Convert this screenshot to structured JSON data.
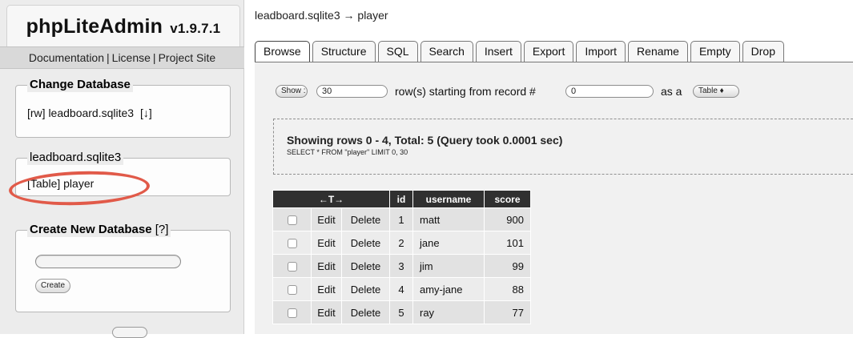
{
  "sidebar": {
    "app_name": "phpLiteAdmin",
    "version": "v1.9.7.1",
    "links": [
      "Documentation",
      "License",
      "Project Site"
    ],
    "link_separator": "|",
    "change_db": {
      "legend": "Change Database",
      "current": "[rw] leadboard.sqlite3",
      "download_icon": "[↓]"
    },
    "db_tables": {
      "legend": "leadboard.sqlite3",
      "table_item": "[Table] player"
    },
    "create_db": {
      "legend": "Create New Database",
      "help": "[?]",
      "name_value": "",
      "button": "Create"
    },
    "annotation_color": "#e15a49"
  },
  "main": {
    "breadcrumb": "leadboard.sqlite3 → player",
    "tabs": [
      {
        "label": "Browse",
        "active": true
      },
      {
        "label": "Structure"
      },
      {
        "label": "SQL"
      },
      {
        "label": "Search"
      },
      {
        "label": "Insert"
      },
      {
        "label": "Export"
      },
      {
        "label": "Import"
      },
      {
        "label": "Rename"
      },
      {
        "label": "Empty"
      },
      {
        "label": "Drop"
      }
    ],
    "show_controls": {
      "show_button": "Show :",
      "rows_value": "30",
      "rows_text": "row(s) starting from record #",
      "start_value": "0",
      "as_a_text": "as a",
      "view_select": "Table ♦"
    },
    "query": {
      "title": "Showing rows 0 - 4, Total: 5 (Query took 0.0001 sec)",
      "sql": "SELECT * FROM \"player\" LIMIT 0, 30"
    },
    "table": {
      "headers": [
        "←T→",
        "id",
        "username",
        "score"
      ],
      "rows": [
        {
          "edit": "Edit",
          "delete": "Delete",
          "id": "1",
          "username": "matt",
          "score": "900"
        },
        {
          "edit": "Edit",
          "delete": "Delete",
          "id": "2",
          "username": "jane",
          "score": "101"
        },
        {
          "edit": "Edit",
          "delete": "Delete",
          "id": "3",
          "username": "jim",
          "score": "99"
        },
        {
          "edit": "Edit",
          "delete": "Delete",
          "id": "4",
          "username": "amy-jane",
          "score": "88"
        },
        {
          "edit": "Edit",
          "delete": "Delete",
          "id": "5",
          "username": "ray",
          "score": "77"
        }
      ]
    }
  }
}
